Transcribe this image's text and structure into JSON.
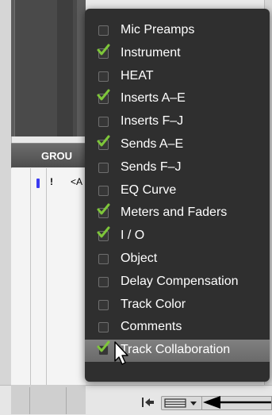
{
  "groups_panel": {
    "title": "GROU",
    "row": {
      "flag": "!",
      "text": "<A"
    }
  },
  "menu": {
    "items": [
      {
        "label": "Mic Preamps",
        "checked": false
      },
      {
        "label": "Instrument",
        "checked": true
      },
      {
        "label": "HEAT",
        "checked": false
      },
      {
        "label": "Inserts A–E",
        "checked": true
      },
      {
        "label": "Inserts F–J",
        "checked": false
      },
      {
        "label": "Sends A–E",
        "checked": true
      },
      {
        "label": "Sends F–J",
        "checked": false
      },
      {
        "label": "EQ Curve",
        "checked": false
      },
      {
        "label": "Meters and Faders",
        "checked": true
      },
      {
        "label": "I / O",
        "checked": true
      },
      {
        "label": "Object",
        "checked": false
      },
      {
        "label": "Delay Compensation",
        "checked": false
      },
      {
        "label": "Track Color",
        "checked": false
      },
      {
        "label": "Comments",
        "checked": false
      },
      {
        "label": "Track Collaboration",
        "checked": true,
        "highlighted": true
      }
    ]
  },
  "icons": {
    "check": "checkmark-icon",
    "collapse": "collapse-left-icon",
    "view_menu": "view-selector-icon",
    "annotation": "callout-arrow-icon"
  },
  "colors": {
    "menu_bg": "#2f2f2f",
    "check_green": "#7ec63a",
    "highlight": "#757575",
    "group_marker": "#3a3af0"
  }
}
